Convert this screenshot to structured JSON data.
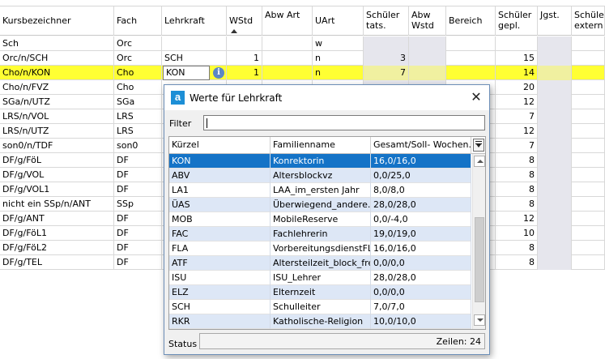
{
  "main_table": {
    "headers": [
      "Kursbezeichner",
      "Fach",
      "Lehrkraft",
      "WStd",
      "Abw Art",
      "UArt",
      "Schüler tats.",
      "Abw Wstd",
      "Bereich",
      "Schüler gepl.",
      "Jgst.",
      "Schüler extern"
    ],
    "rows": [
      [
        "Sch",
        "Orc",
        "",
        "",
        "",
        "w",
        "",
        "",
        "",
        "",
        "",
        ""
      ],
      [
        "Orc/n/SCH",
        "Orc",
        "SCH",
        "1",
        "",
        "n",
        "3",
        "",
        "",
        "15",
        "",
        ""
      ],
      [
        "Cho/n/KON",
        "Cho",
        "KON",
        "1",
        "",
        "n",
        "7",
        "",
        "",
        "14",
        "",
        ""
      ],
      [
        "Cho/n/FVZ",
        "Cho",
        "",
        "",
        "",
        "",
        "",
        "",
        "",
        "20",
        "",
        ""
      ],
      [
        "SGa/n/UTZ",
        "SGa",
        "",
        "",
        "",
        "",
        "",
        "",
        "",
        "12",
        "",
        ""
      ],
      [
        "LRS/n/VOL",
        "LRS",
        "",
        "",
        "",
        "",
        "",
        "",
        "",
        "7",
        "",
        ""
      ],
      [
        "LRS/n/UTZ",
        "LRS",
        "",
        "",
        "",
        "",
        "",
        "",
        "",
        "12",
        "",
        ""
      ],
      [
        "son0/n/TDF",
        "son0",
        "",
        "",
        "",
        "",
        "",
        "",
        "",
        "7",
        "",
        ""
      ],
      [
        "DF/g/FöL",
        "DF",
        "",
        "",
        "",
        "",
        "",
        "",
        "",
        "8",
        "",
        ""
      ],
      [
        "DF/g/VOL",
        "DF",
        "",
        "",
        "",
        "",
        "",
        "",
        "",
        "8",
        "",
        ""
      ],
      [
        "DF/g/VOL1",
        "DF",
        "",
        "",
        "",
        "",
        "",
        "",
        "",
        "8",
        "",
        ""
      ],
      [
        "nicht ein SSp/n/ANT",
        "SSp",
        "",
        "",
        "",
        "",
        "",
        "",
        "",
        "8",
        "",
        ""
      ],
      [
        "DF/g/ANT",
        "DF",
        "",
        "",
        "",
        "",
        "",
        "",
        "",
        "12",
        "",
        ""
      ],
      [
        "DF/g/FöL1",
        "DF",
        "",
        "",
        "",
        "",
        "",
        "",
        "",
        "10",
        "",
        ""
      ],
      [
        "DF/g/FöL2",
        "DF",
        "",
        "",
        "",
        "",
        "",
        "",
        "",
        "8",
        "",
        ""
      ],
      [
        "DF/g/TEL",
        "DF",
        "",
        "",
        "",
        "",
        "",
        "",
        "",
        "8",
        "",
        ""
      ]
    ],
    "selected_row_index": 2,
    "editing_value": "KON"
  },
  "dialog": {
    "app_icon_letter": "a",
    "title": "Werte für Lehrkraft",
    "filter_label": "Filter",
    "filter_value": "",
    "columns": [
      "Kürzel",
      "Familienname",
      "Gesamt/Soll- Wochen..."
    ],
    "rows": [
      [
        "KON",
        "Konrektorin",
        "16,0/16,0"
      ],
      [
        "ABV",
        "Altersblockvz",
        "0,0/25,0"
      ],
      [
        "LA1",
        "LAA_im_ersten Jahr",
        "8,0/8,0"
      ],
      [
        "ÜAS",
        "Überwiegend_andere...",
        "28,0/28,0"
      ],
      [
        "MOB",
        "MobileReserve",
        "0,0/-4,0"
      ],
      [
        "FAC",
        "Fachlehrerin",
        "19,0/19,0"
      ],
      [
        "FLA",
        "VorbereitungsdienstFL",
        "16,0/16,0"
      ],
      [
        "ATF",
        "Altersteilzeit_block_frei",
        "0,0/0,0"
      ],
      [
        "ISU",
        "ISU_Lehrer",
        "28,0/28,0"
      ],
      [
        "ELZ",
        "Elternzeit",
        "0,0/0,0"
      ],
      [
        "SCH",
        "Schulleiter",
        "7,0/7,0"
      ],
      [
        "RKR",
        "Katholische-Religion",
        "10,0/10,0"
      ]
    ],
    "selected_row_index": 0,
    "status_label": "Status",
    "status_count": "Zeilen: 24"
  },
  "colors": {
    "selected_row": "#ffff33",
    "dialog_selection": "#1473c7",
    "dialog_alt_row": "#dde7f6",
    "shaded_column": "#e6e6ed"
  },
  "icons": {
    "info": "info-icon",
    "close": "close-icon",
    "sort": "sort-ascending-icon",
    "column_chooser": "column-chooser-icon"
  }
}
